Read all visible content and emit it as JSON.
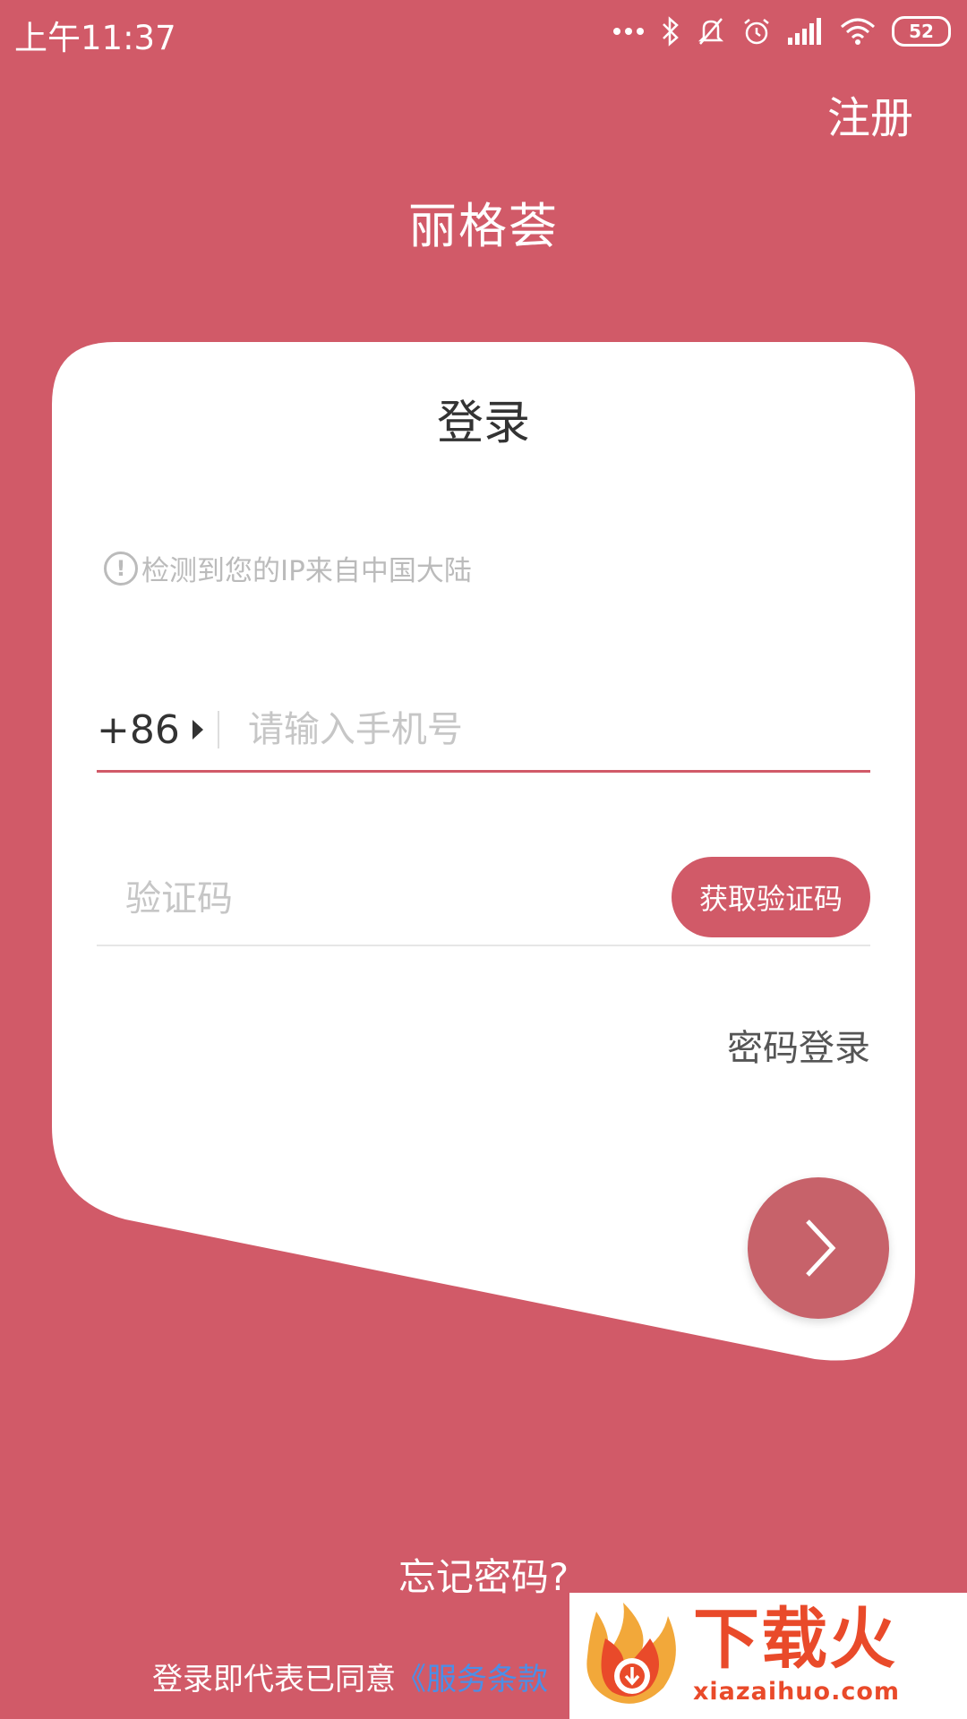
{
  "status_bar": {
    "time": "上午11:37",
    "icons": [
      "more-dots-icon",
      "bluetooth-icon",
      "mute-bell-icon",
      "alarm-icon",
      "signal-icon",
      "wifi-icon",
      "battery-icon"
    ],
    "battery": "52"
  },
  "header": {
    "register_label": "注册",
    "app_name": "丽格荟"
  },
  "card": {
    "title": "登录",
    "ip_notice": "检测到您的IP来自中国大陆",
    "country_code": "+86",
    "phone_placeholder": "请输入手机号",
    "code_placeholder": "验证码",
    "get_code_label": "获取验证码",
    "password_login_label": "密码登录"
  },
  "footer": {
    "forgot_password": "忘记密码?",
    "agreement_prefix": "登录即代表已同意",
    "agreement_link": "《服务条款"
  },
  "watermark": {
    "title": "下载火",
    "domain": "xiazaihuo.com"
  },
  "colors": {
    "brand": "#D15A68",
    "button_dark": "#C7626A",
    "link": "#4A8FE8",
    "watermark": "#E94A2A"
  }
}
